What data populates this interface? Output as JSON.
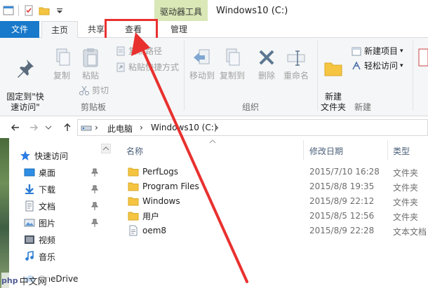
{
  "window": {
    "title": "Windows10 (C:)",
    "context_tab_header": "驱动器工具"
  },
  "ribbon_tabs": {
    "file": "文件",
    "home": "主页",
    "share": "共享",
    "view": "查看",
    "manage": "管理"
  },
  "clipboard": {
    "pin": "固定到\"快\n速访问\"",
    "copy": "复制",
    "paste": "粘贴",
    "copy_path": "复制路径",
    "paste_shortcut": "粘贴快捷方式",
    "cut": "剪切",
    "group": "剪贴板"
  },
  "organize": {
    "move_to": "移动到",
    "copy_to": "复制到",
    "delete": "删除",
    "rename": "重命名",
    "group": "组织"
  },
  "new": {
    "new_folder": "新建\n文件夹",
    "new_item": "新建项目",
    "easy_access": "轻松访问",
    "group": "新建"
  },
  "address": {
    "crumb1": "此电脑",
    "crumb2": "Windows10 (C:)"
  },
  "nav": {
    "quick_access": "快速访问",
    "items": [
      "桌面",
      "下载",
      "文档",
      "图片",
      "视频",
      "音乐",
      "OneDrive"
    ]
  },
  "columns": {
    "name": "名称",
    "date": "修改日期",
    "type": "类型"
  },
  "files": [
    {
      "name": "PerfLogs",
      "date": "2015/7/10 16:28",
      "type": "文件夹"
    },
    {
      "name": "Program Files",
      "date": "2015/8/8 19:35",
      "type": "文件夹"
    },
    {
      "name": "Windows",
      "date": "2015/8/9 22:12",
      "type": "文件夹"
    },
    {
      "name": "用户",
      "date": "2015/8/5 12:56",
      "type": "文件夹"
    },
    {
      "name": "oem8",
      "date": "2015/8/9 22:28",
      "type": "文本文档"
    }
  ],
  "watermark": {
    "php": "php",
    "site": "中文网"
  },
  "colors": {
    "file_tab": "#1979ca",
    "context_tab": "#d9e8b6",
    "annotation": "#e8312f",
    "folder": "#f5c542"
  }
}
